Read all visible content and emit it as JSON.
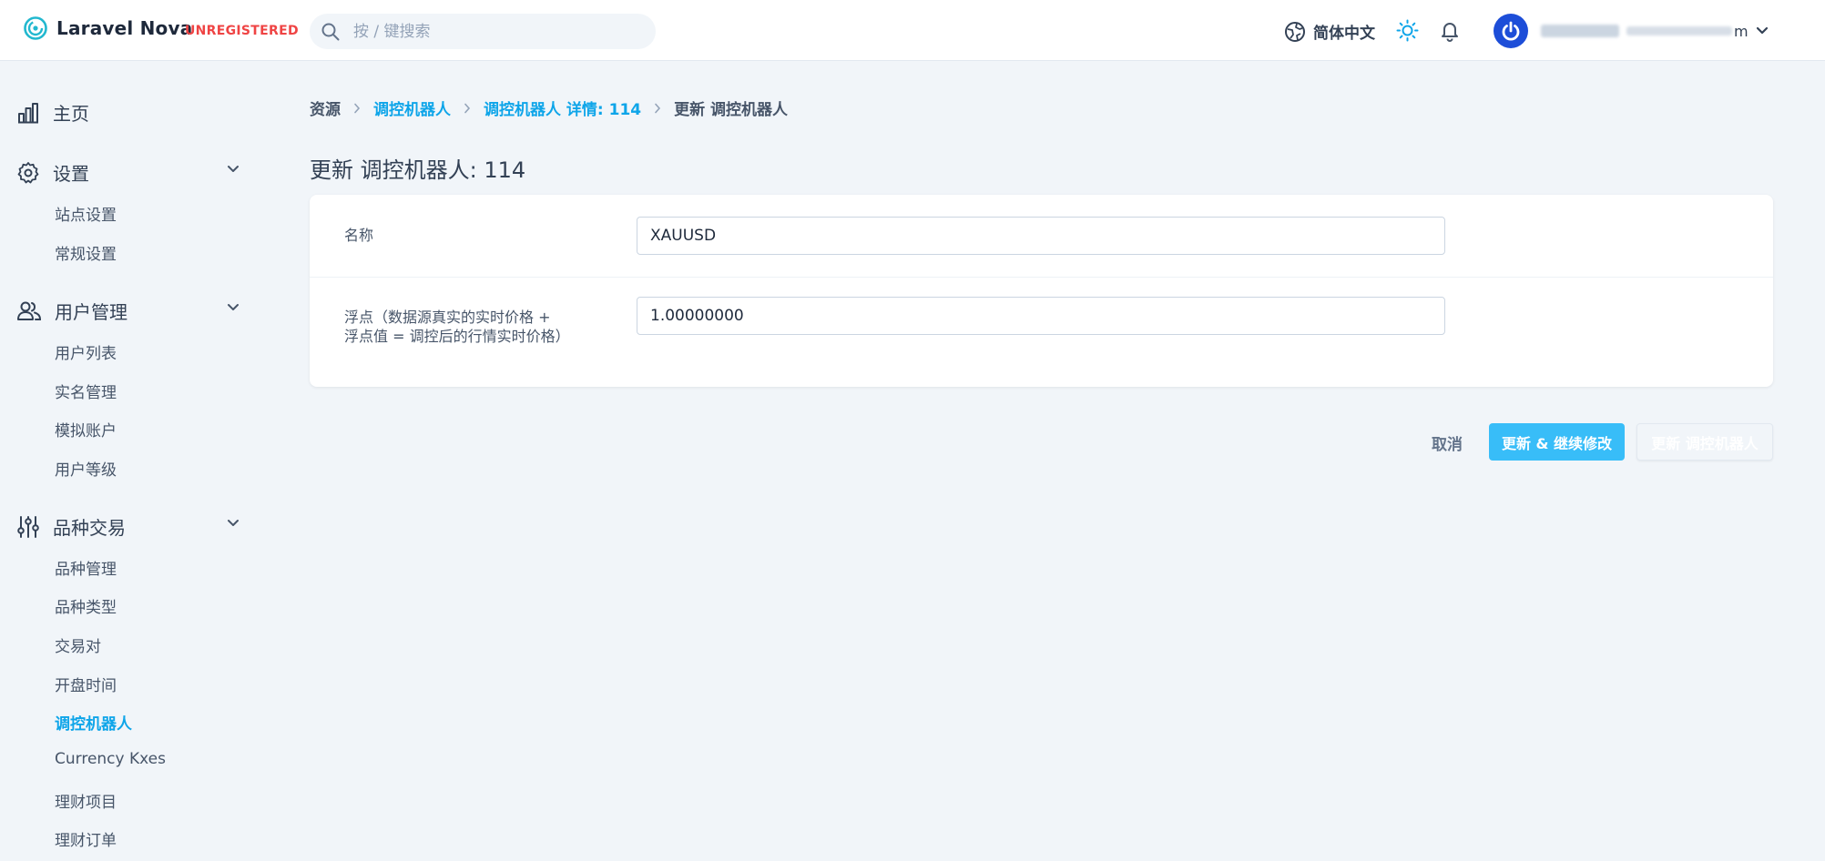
{
  "header": {
    "app_name": "Laravel Nova",
    "badge": "UNREGISTERED",
    "search_placeholder": "按 / 键搜索",
    "language": "简体中文",
    "user_suffix": "m"
  },
  "sidebar": {
    "home": "主页",
    "sections": [
      {
        "label": "设置",
        "icon": "gear-icon",
        "items": [
          "站点设置",
          "常规设置"
        ]
      },
      {
        "label": "用户管理",
        "icon": "users-icon",
        "items": [
          "用户列表",
          "实名管理",
          "模拟账户",
          "用户等级"
        ]
      },
      {
        "label": "品种交易",
        "icon": "sliders-icon",
        "items": [
          "品种管理",
          "品种类型",
          "交易对",
          "开盘时间",
          "调控机器人",
          "Currency Kxes",
          "理财项目",
          "理财订单"
        ]
      }
    ],
    "active_item": "调控机器人"
  },
  "breadcrumb": {
    "root": "资源",
    "resource": "调控机器人",
    "detail": "调控机器人 详情: 114",
    "current": "更新 调控机器人"
  },
  "page": {
    "title": "更新 调控机器人: 114"
  },
  "form": {
    "name_label": "名称",
    "name_value": "XAUUSD",
    "float_label": "浮点（数据源真实的实时价格 + 浮点值 = 调控后的行情实时价格）",
    "float_value": "1.00000000"
  },
  "actions": {
    "cancel": "取消",
    "update_continue": "更新 & 继续修改",
    "update": "更新 调控机器人"
  },
  "colors": {
    "accent": "#0ea5e9",
    "primary_button": "#38bdf8",
    "badge": "#ef4444"
  }
}
